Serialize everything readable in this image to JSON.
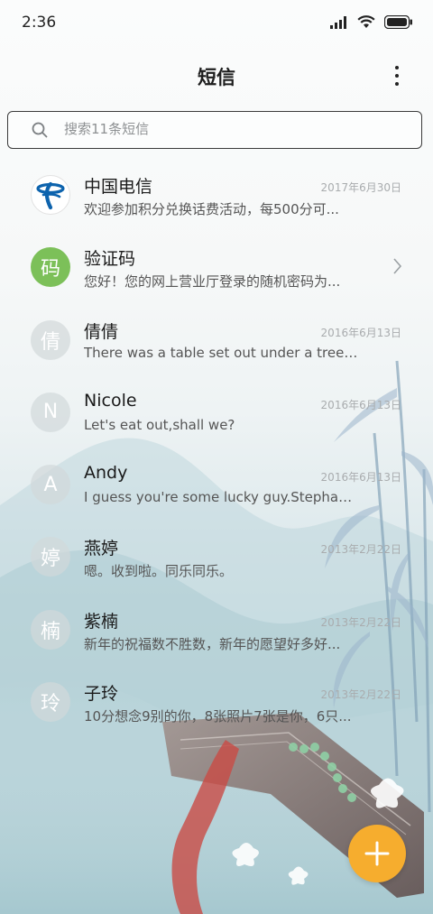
{
  "status_bar": {
    "time": "2:36"
  },
  "header": {
    "title": "短信"
  },
  "search": {
    "placeholder": "搜索11条短信"
  },
  "conversations": [
    {
      "name": "中国电信",
      "date": "2017年6月30日",
      "snippet": "欢迎参加积分兑换话费活动，每500分可...",
      "avatar_text": "",
      "avatar_icon": "china-telecom-logo"
    },
    {
      "name": "验证码",
      "date": "",
      "snippet": "您好！您的网上营业厅登录的随机密码为...",
      "avatar_text": "码",
      "avatar_color": "#7cc059"
    },
    {
      "name": "倩倩",
      "date": "2016年6月13日",
      "snippet": "There was a table set out under a tree i...",
      "avatar_text": "倩"
    },
    {
      "name": "Nicole",
      "date": "2016年6月13日",
      "snippet": "Let's eat out,shall we?",
      "avatar_text": "N"
    },
    {
      "name": "Andy",
      "date": "2016年6月13日",
      "snippet": "I guess you're some lucky guy.Stephan...",
      "avatar_text": "A"
    },
    {
      "name": "燕婷",
      "date": "2013年2月22日",
      "snippet": "嗯。收到啦。同乐同乐。",
      "avatar_text": "婷"
    },
    {
      "name": "紫楠",
      "date": "2013年2月22日",
      "snippet": "新年的祝福数不胜数，新年的愿望好多好...",
      "avatar_text": "楠"
    },
    {
      "name": "子玲",
      "date": "2013年2月22日",
      "snippet": "10分想念9别的你，8张照片7张是你，6只...",
      "avatar_text": "玲"
    }
  ],
  "colors": {
    "fab": "#f6ad2e",
    "accent_green": "#7cc059"
  }
}
